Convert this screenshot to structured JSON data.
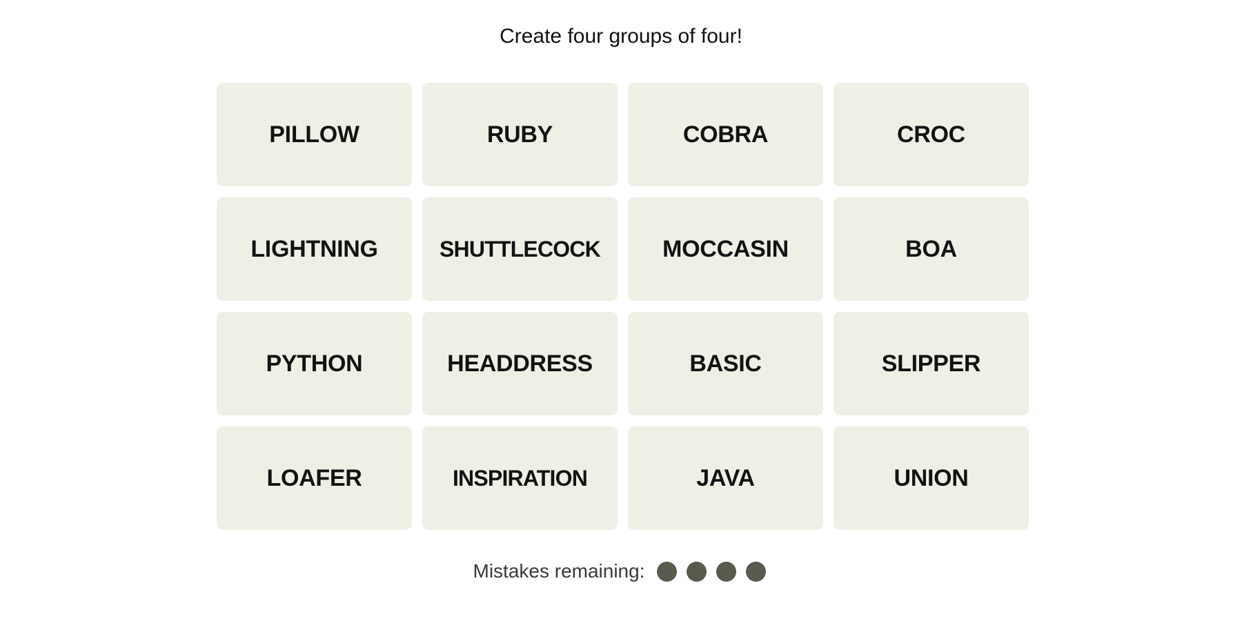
{
  "header": {
    "title": "Create four groups of four!"
  },
  "tiles": [
    {
      "label": "PILLOW"
    },
    {
      "label": "RUBY"
    },
    {
      "label": "COBRA"
    },
    {
      "label": "CROC"
    },
    {
      "label": "LIGHTNING"
    },
    {
      "label": "SHUTTLECOCK"
    },
    {
      "label": "MOCCASIN"
    },
    {
      "label": "BOA"
    },
    {
      "label": "PYTHON"
    },
    {
      "label": "HEADDRESS"
    },
    {
      "label": "BASIC"
    },
    {
      "label": "SLIPPER"
    },
    {
      "label": "LOAFER"
    },
    {
      "label": "INSPIRATION"
    },
    {
      "label": "JAVA"
    },
    {
      "label": "UNION"
    }
  ],
  "mistakes": {
    "label": "Mistakes remaining:",
    "remaining": 4,
    "total": 4,
    "dot_color": "#5a594e"
  },
  "colors": {
    "tile_bg": "#efefe6",
    "text": "#121212"
  }
}
